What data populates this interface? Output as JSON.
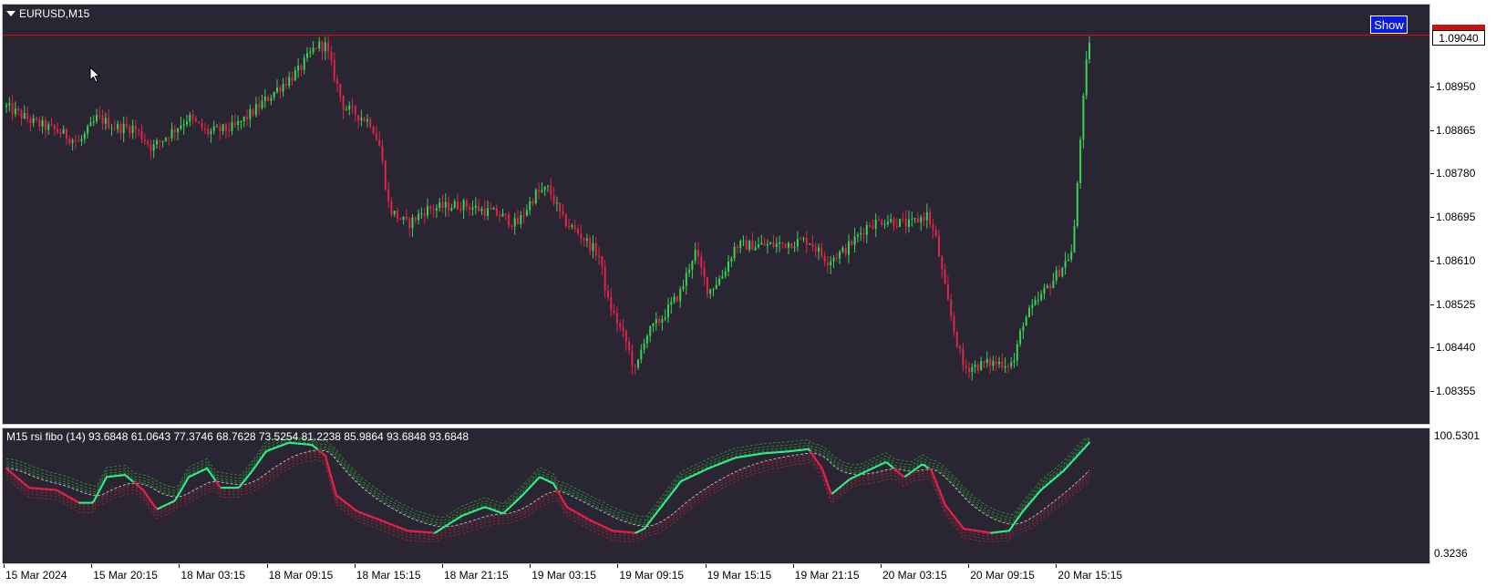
{
  "main_chart": {
    "title": "EURUSD,M15",
    "show_button": "Show",
    "current_price": "1.09040",
    "price_labels": [
      "1.08950",
      "1.08865",
      "1.08780",
      "1.08695",
      "1.08610",
      "1.08525",
      "1.08440",
      "1.08355"
    ],
    "up_color": "#39d353",
    "down_color": "#e0244a",
    "ask_line_color": "#d01010"
  },
  "indicator": {
    "title": "M15 rsi fibo (14) 93.6848 61.0643 77.3746 68.7628 73.5254 81.2238 85.9864 93.6848 93.6848",
    "max_label": "100.5301",
    "min_label": "0.3236",
    "rsi_up_color": "#2ef08a",
    "rsi_down_color": "#e8204a"
  },
  "time_labels": [
    "15 Mar 2024",
    "15 Mar 20:15",
    "18 Mar 03:15",
    "18 Mar 09:15",
    "18 Mar 15:15",
    "18 Mar 21:15",
    "19 Mar 03:15",
    "19 Mar 09:15",
    "19 Mar 15:15",
    "19 Mar 21:15",
    "20 Mar 03:15",
    "20 Mar 09:15",
    "20 Mar 15:15"
  ],
  "chart_data": {
    "type": "candlestick",
    "symbol": "EURUSD",
    "timeframe": "M15",
    "ylim": [
      1.0831,
      1.0911
    ],
    "yticks": [
      1.0895,
      1.08865,
      1.0878,
      1.08695,
      1.0861,
      1.08525,
      1.0844,
      1.08355
    ],
    "current_price": 1.0904,
    "close_path": [
      [
        0,
        1.0891
      ],
      [
        30,
        1.0888
      ],
      [
        60,
        1.0886
      ],
      [
        80,
        1.0884
      ],
      [
        100,
        1.0889
      ],
      [
        120,
        1.0887
      ],
      [
        140,
        1.0887
      ],
      [
        160,
        1.0883
      ],
      [
        180,
        1.0886
      ],
      [
        200,
        1.0889
      ],
      [
        220,
        1.0886
      ],
      [
        250,
        1.0887
      ],
      [
        270,
        1.089
      ],
      [
        300,
        1.0895
      ],
      [
        320,
        1.0898
      ],
      [
        340,
        1.0903
      ],
      [
        350,
        1.0903
      ],
      [
        355,
        1.09
      ],
      [
        370,
        1.0891
      ],
      [
        390,
        1.0889
      ],
      [
        400,
        1.0888
      ],
      [
        410,
        1.0883
      ],
      [
        420,
        1.0871
      ],
      [
        440,
        1.0868
      ],
      [
        460,
        1.0871
      ],
      [
        500,
        1.0872
      ],
      [
        540,
        1.087
      ],
      [
        560,
        1.0868
      ],
      [
        580,
        1.0874
      ],
      [
        595,
        1.0875
      ],
      [
        610,
        1.0869
      ],
      [
        630,
        1.0866
      ],
      [
        650,
        1.0862
      ],
      [
        660,
        1.0853
      ],
      [
        680,
        1.0845
      ],
      [
        690,
        1.0839
      ],
      [
        700,
        1.0846
      ],
      [
        720,
        1.085
      ],
      [
        740,
        1.0855
      ],
      [
        755,
        1.0863
      ],
      [
        770,
        1.0855
      ],
      [
        785,
        1.0858
      ],
      [
        800,
        1.0864
      ],
      [
        840,
        1.0864
      ],
      [
        880,
        1.0865
      ],
      [
        900,
        1.0861
      ],
      [
        920,
        1.0863
      ],
      [
        945,
        1.0868
      ],
      [
        965,
        1.0869
      ],
      [
        990,
        1.0868
      ],
      [
        1010,
        1.087
      ],
      [
        1020,
        1.0865
      ],
      [
        1030,
        1.0855
      ],
      [
        1040,
        1.0847
      ],
      [
        1050,
        1.084
      ],
      [
        1080,
        1.0841
      ],
      [
        1105,
        1.0841
      ],
      [
        1115,
        1.0849
      ],
      [
        1135,
        1.0854
      ],
      [
        1155,
        1.0859
      ],
      [
        1170,
        1.0863
      ],
      [
        1178,
        1.0885
      ],
      [
        1185,
        1.09
      ],
      [
        1188,
        1.0904
      ]
    ],
    "indicator": {
      "name": "rsi fibo (14)",
      "ylim": [
        0.3236,
        100.5301
      ],
      "rsi_path": [
        [
          0,
          70
        ],
        [
          25,
          52
        ],
        [
          55,
          50
        ],
        [
          80,
          38
        ],
        [
          95,
          38
        ],
        [
          110,
          62
        ],
        [
          130,
          64
        ],
        [
          150,
          50
        ],
        [
          165,
          32
        ],
        [
          185,
          40
        ],
        [
          200,
          62
        ],
        [
          220,
          70
        ],
        [
          235,
          52
        ],
        [
          255,
          52
        ],
        [
          270,
          68
        ],
        [
          285,
          86
        ],
        [
          310,
          94
        ],
        [
          335,
          92
        ],
        [
          350,
          82
        ],
        [
          362,
          45
        ],
        [
          385,
          30
        ],
        [
          410,
          22
        ],
        [
          440,
          12
        ],
        [
          470,
          10
        ],
        [
          500,
          26
        ],
        [
          525,
          34
        ],
        [
          545,
          28
        ],
        [
          565,
          44
        ],
        [
          585,
          62
        ],
        [
          600,
          56
        ],
        [
          615,
          34
        ],
        [
          640,
          22
        ],
        [
          665,
          12
        ],
        [
          690,
          10
        ],
        [
          700,
          14
        ],
        [
          720,
          36
        ],
        [
          740,
          58
        ],
        [
          770,
          70
        ],
        [
          800,
          80
        ],
        [
          830,
          84
        ],
        [
          860,
          86
        ],
        [
          880,
          88
        ],
        [
          895,
          70
        ],
        [
          905,
          46
        ],
        [
          925,
          60
        ],
        [
          945,
          68
        ],
        [
          965,
          76
        ],
        [
          985,
          62
        ],
        [
          1005,
          74
        ],
        [
          1015,
          68
        ],
        [
          1030,
          36
        ],
        [
          1050,
          14
        ],
        [
          1080,
          10
        ],
        [
          1100,
          12
        ],
        [
          1115,
          30
        ],
        [
          1135,
          50
        ],
        [
          1160,
          68
        ],
        [
          1188,
          94
        ]
      ]
    }
  }
}
